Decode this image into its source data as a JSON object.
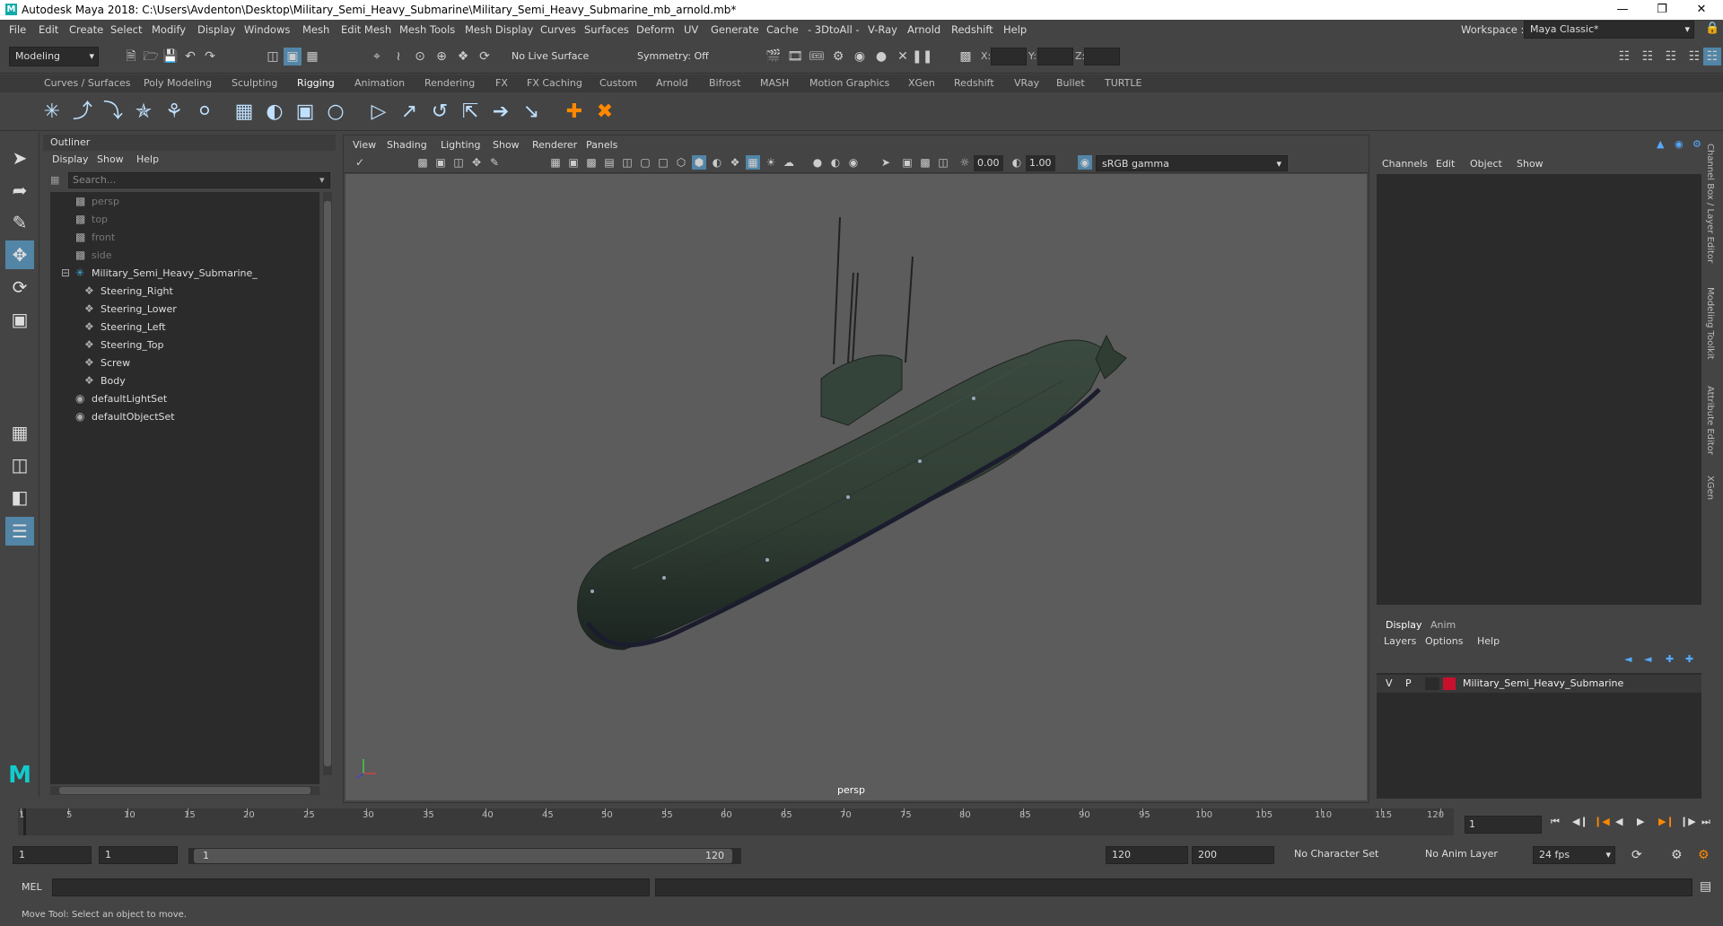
{
  "window": {
    "title": "Autodesk Maya 2018: C:\\Users\\Avdenton\\Desktop\\Military_Semi_Heavy_Submarine\\Military_Semi_Heavy_Submarine_mb_arnold.mb*",
    "logo": "M"
  },
  "menubar": [
    "File",
    "Edit",
    "Create",
    "Select",
    "Modify",
    "Display",
    "Windows",
    "Mesh",
    "Edit Mesh",
    "Mesh Tools",
    "Mesh Display",
    "Curves",
    "Surfaces",
    "Deform",
    "UV",
    "Generate",
    "Cache",
    "- 3DtoAll -",
    "V-Ray",
    "Arnold",
    "Redshift",
    "Help"
  ],
  "statusline": {
    "mode": "Modeling",
    "live_surface": "No Live Surface",
    "symmetry": "Symmetry: Off",
    "x_label": "X:",
    "y_label": "Y:",
    "z_label": "Z:",
    "workspace_label": "Workspace :",
    "workspace": "Maya Classic*"
  },
  "shelf_tabs": [
    "Curves / Surfaces",
    "Poly Modeling",
    "Sculpting",
    "Rigging",
    "Animation",
    "Rendering",
    "FX",
    "FX Caching",
    "Custom",
    "Arnold",
    "Bifrost",
    "MASH",
    "Motion Graphics",
    "XGen",
    "Redshift",
    "VRay",
    "Bullet",
    "TURTLE"
  ],
  "active_shelf_tab": "Rigging",
  "outliner": {
    "title": "Outliner",
    "menu": [
      "Display",
      "Show",
      "Help"
    ],
    "search_placeholder": "Search...",
    "items": [
      {
        "label": "persp",
        "dim": true
      },
      {
        "label": "top",
        "dim": true
      },
      {
        "label": "front",
        "dim": true
      },
      {
        "label": "side",
        "dim": true
      },
      {
        "label": "Military_Semi_Heavy_Submarine_",
        "dim": false
      },
      {
        "label": "Steering_Right",
        "dim": false
      },
      {
        "label": "Steering_Lower",
        "dim": false
      },
      {
        "label": "Steering_Left",
        "dim": false
      },
      {
        "label": "Steering_Top",
        "dim": false
      },
      {
        "label": "Screw",
        "dim": false
      },
      {
        "label": "Body",
        "dim": false
      },
      {
        "label": "defaultLightSet",
        "dim": false
      },
      {
        "label": "defaultObjectSet",
        "dim": false
      }
    ]
  },
  "viewport": {
    "menu": [
      "View",
      "Shading",
      "Lighting",
      "Show",
      "Renderer",
      "Panels"
    ],
    "exposure": "0.00",
    "gamma": "1.00",
    "color_space": "sRGB gamma",
    "camera_label": "persp"
  },
  "channel_box": {
    "menu": [
      "Channels",
      "Edit",
      "Object",
      "Show"
    ]
  },
  "layer_editor": {
    "tabs": [
      "Display",
      "Anim"
    ],
    "menu": [
      "Layers",
      "Options",
      "Help"
    ],
    "layer": {
      "v": "V",
      "p": "P",
      "name": "Military_Semi_Heavy_Submarine",
      "color": "#c8102e"
    }
  },
  "side_tabs": [
    "Channel Box / Layer Editor",
    "Modeling Toolkit",
    "Attribute Editor",
    "XGen"
  ],
  "timeline": {
    "ticks": [
      "1",
      "5",
      "10",
      "15",
      "20",
      "25",
      "30",
      "35",
      "40",
      "45",
      "50",
      "55",
      "60",
      "65",
      "70",
      "75",
      "80",
      "85",
      "90",
      "95",
      "100",
      "105",
      "110",
      "115",
      "120"
    ],
    "current_frame": "1"
  },
  "range": {
    "start": "1",
    "anim_start": "1",
    "slider_start": "1",
    "slider_end": "120",
    "anim_end": "120",
    "end": "200",
    "character_set": "No Character Set",
    "anim_layer": "No Anim Layer",
    "fps": "24 fps"
  },
  "cmdline": {
    "label": "MEL"
  },
  "helpline": {
    "text": "Move Tool: Select an object to move."
  }
}
